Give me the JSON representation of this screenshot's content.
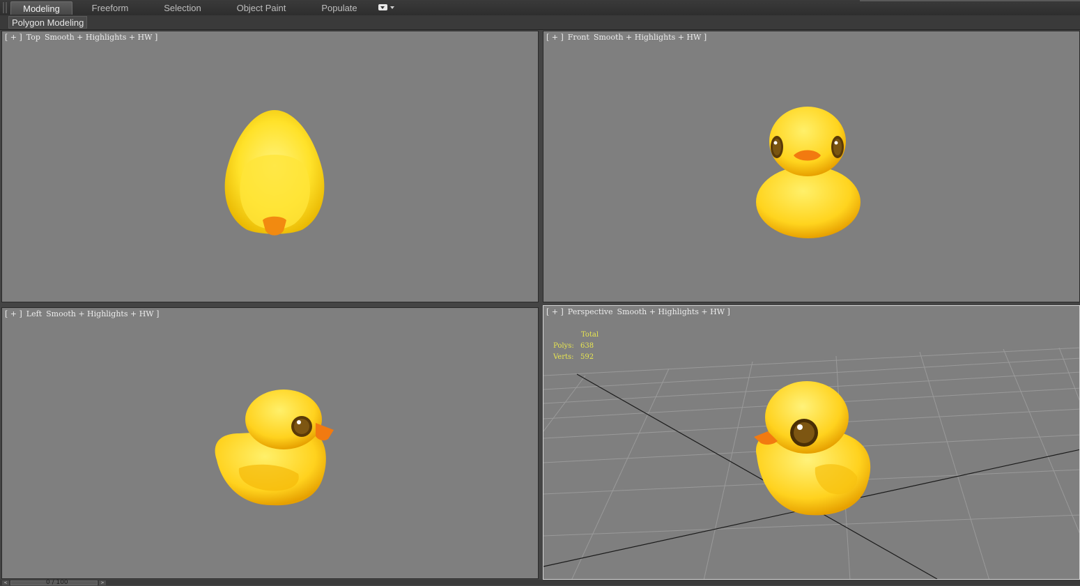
{
  "ribbon": {
    "tabs": [
      {
        "label": "Modeling",
        "active": true
      },
      {
        "label": "Freeform",
        "active": false
      },
      {
        "label": "Selection",
        "active": false
      },
      {
        "label": "Object Paint",
        "active": false
      },
      {
        "label": "Populate",
        "active": false
      }
    ],
    "panel_label": "Polygon Modeling"
  },
  "viewports": {
    "top": {
      "plus": "[ + ]",
      "view": "Top",
      "shading": "Smooth + Highlights + HW ]"
    },
    "front": {
      "plus": "[ + ]",
      "view": "Front",
      "shading": "Smooth + Highlights + HW ]"
    },
    "left": {
      "plus": "[ + ]",
      "view": "Left",
      "shading": "Smooth + Highlights + HW ]"
    },
    "perspective": {
      "plus": "[ + ]",
      "view": "Perspective",
      "shading": "Smooth + Highlights + HW ]"
    }
  },
  "stats": {
    "header": "Total",
    "polys_label": "Polys:",
    "polys_value": "638",
    "verts_label": "Verts:",
    "verts_value": "592"
  },
  "timeline": {
    "label": "0 / 100",
    "prev": "<",
    "next": ">"
  },
  "colors": {
    "viewport_bg": "#7f7f7f",
    "stats_text": "#e8e650",
    "duck_yellow": "#ffd21e",
    "beak_orange": "#f28a10"
  }
}
